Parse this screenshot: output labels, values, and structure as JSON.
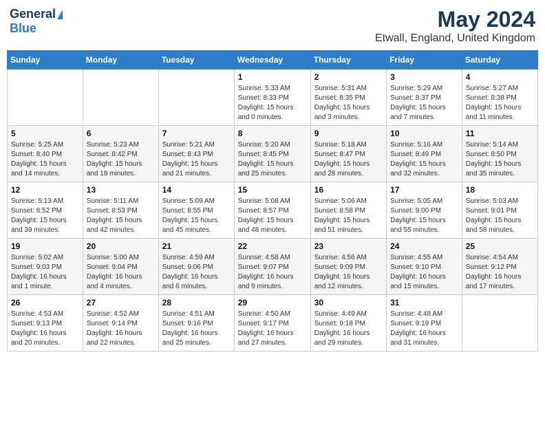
{
  "logo": {
    "general": "General",
    "blue": "Blue"
  },
  "title": "May 2024",
  "location": "Etwall, England, United Kingdom",
  "days_of_week": [
    "Sunday",
    "Monday",
    "Tuesday",
    "Wednesday",
    "Thursday",
    "Friday",
    "Saturday"
  ],
  "weeks": [
    [
      {
        "day": "",
        "info": ""
      },
      {
        "day": "",
        "info": ""
      },
      {
        "day": "",
        "info": ""
      },
      {
        "day": "1",
        "info": "Sunrise: 5:33 AM\nSunset: 8:33 PM\nDaylight: 15 hours\nand 0 minutes."
      },
      {
        "day": "2",
        "info": "Sunrise: 5:31 AM\nSunset: 8:35 PM\nDaylight: 15 hours\nand 3 minutes."
      },
      {
        "day": "3",
        "info": "Sunrise: 5:29 AM\nSunset: 8:37 PM\nDaylight: 15 hours\nand 7 minutes."
      },
      {
        "day": "4",
        "info": "Sunrise: 5:27 AM\nSunset: 8:38 PM\nDaylight: 15 hours\nand 11 minutes."
      }
    ],
    [
      {
        "day": "5",
        "info": "Sunrise: 5:25 AM\nSunset: 8:40 PM\nDaylight: 15 hours\nand 14 minutes."
      },
      {
        "day": "6",
        "info": "Sunrise: 5:23 AM\nSunset: 8:42 PM\nDaylight: 15 hours\nand 18 minutes."
      },
      {
        "day": "7",
        "info": "Sunrise: 5:21 AM\nSunset: 8:43 PM\nDaylight: 15 hours\nand 21 minutes."
      },
      {
        "day": "8",
        "info": "Sunrise: 5:20 AM\nSunset: 8:45 PM\nDaylight: 15 hours\nand 25 minutes."
      },
      {
        "day": "9",
        "info": "Sunrise: 5:18 AM\nSunset: 8:47 PM\nDaylight: 15 hours\nand 28 minutes."
      },
      {
        "day": "10",
        "info": "Sunrise: 5:16 AM\nSunset: 8:49 PM\nDaylight: 15 hours\nand 32 minutes."
      },
      {
        "day": "11",
        "info": "Sunrise: 5:14 AM\nSunset: 8:50 PM\nDaylight: 15 hours\nand 35 minutes."
      }
    ],
    [
      {
        "day": "12",
        "info": "Sunrise: 5:13 AM\nSunset: 8:52 PM\nDaylight: 15 hours\nand 39 minutes."
      },
      {
        "day": "13",
        "info": "Sunrise: 5:11 AM\nSunset: 8:53 PM\nDaylight: 15 hours\nand 42 minutes."
      },
      {
        "day": "14",
        "info": "Sunrise: 5:09 AM\nSunset: 8:55 PM\nDaylight: 15 hours\nand 45 minutes."
      },
      {
        "day": "15",
        "info": "Sunrise: 5:08 AM\nSunset: 8:57 PM\nDaylight: 15 hours\nand 48 minutes."
      },
      {
        "day": "16",
        "info": "Sunrise: 5:06 AM\nSunset: 8:58 PM\nDaylight: 15 hours\nand 51 minutes."
      },
      {
        "day": "17",
        "info": "Sunrise: 5:05 AM\nSunset: 9:00 PM\nDaylight: 15 hours\nand 55 minutes."
      },
      {
        "day": "18",
        "info": "Sunrise: 5:03 AM\nSunset: 9:01 PM\nDaylight: 15 hours\nand 58 minutes."
      }
    ],
    [
      {
        "day": "19",
        "info": "Sunrise: 5:02 AM\nSunset: 9:03 PM\nDaylight: 16 hours\nand 1 minute."
      },
      {
        "day": "20",
        "info": "Sunrise: 5:00 AM\nSunset: 9:04 PM\nDaylight: 16 hours\nand 4 minutes."
      },
      {
        "day": "21",
        "info": "Sunrise: 4:59 AM\nSunset: 9:06 PM\nDaylight: 16 hours\nand 6 minutes."
      },
      {
        "day": "22",
        "info": "Sunrise: 4:58 AM\nSunset: 9:07 PM\nDaylight: 16 hours\nand 9 minutes."
      },
      {
        "day": "23",
        "info": "Sunrise: 4:56 AM\nSunset: 9:09 PM\nDaylight: 16 hours\nand 12 minutes."
      },
      {
        "day": "24",
        "info": "Sunrise: 4:55 AM\nSunset: 9:10 PM\nDaylight: 16 hours\nand 15 minutes."
      },
      {
        "day": "25",
        "info": "Sunrise: 4:54 AM\nSunset: 9:12 PM\nDaylight: 16 hours\nand 17 minutes."
      }
    ],
    [
      {
        "day": "26",
        "info": "Sunrise: 4:53 AM\nSunset: 9:13 PM\nDaylight: 16 hours\nand 20 minutes."
      },
      {
        "day": "27",
        "info": "Sunrise: 4:52 AM\nSunset: 9:14 PM\nDaylight: 16 hours\nand 22 minutes."
      },
      {
        "day": "28",
        "info": "Sunrise: 4:51 AM\nSunset: 9:16 PM\nDaylight: 16 hours\nand 25 minutes."
      },
      {
        "day": "29",
        "info": "Sunrise: 4:50 AM\nSunset: 9:17 PM\nDaylight: 16 hours\nand 27 minutes."
      },
      {
        "day": "30",
        "info": "Sunrise: 4:49 AM\nSunset: 9:18 PM\nDaylight: 16 hours\nand 29 minutes."
      },
      {
        "day": "31",
        "info": "Sunrise: 4:48 AM\nSunset: 9:19 PM\nDaylight: 16 hours\nand 31 minutes."
      },
      {
        "day": "",
        "info": ""
      }
    ]
  ]
}
